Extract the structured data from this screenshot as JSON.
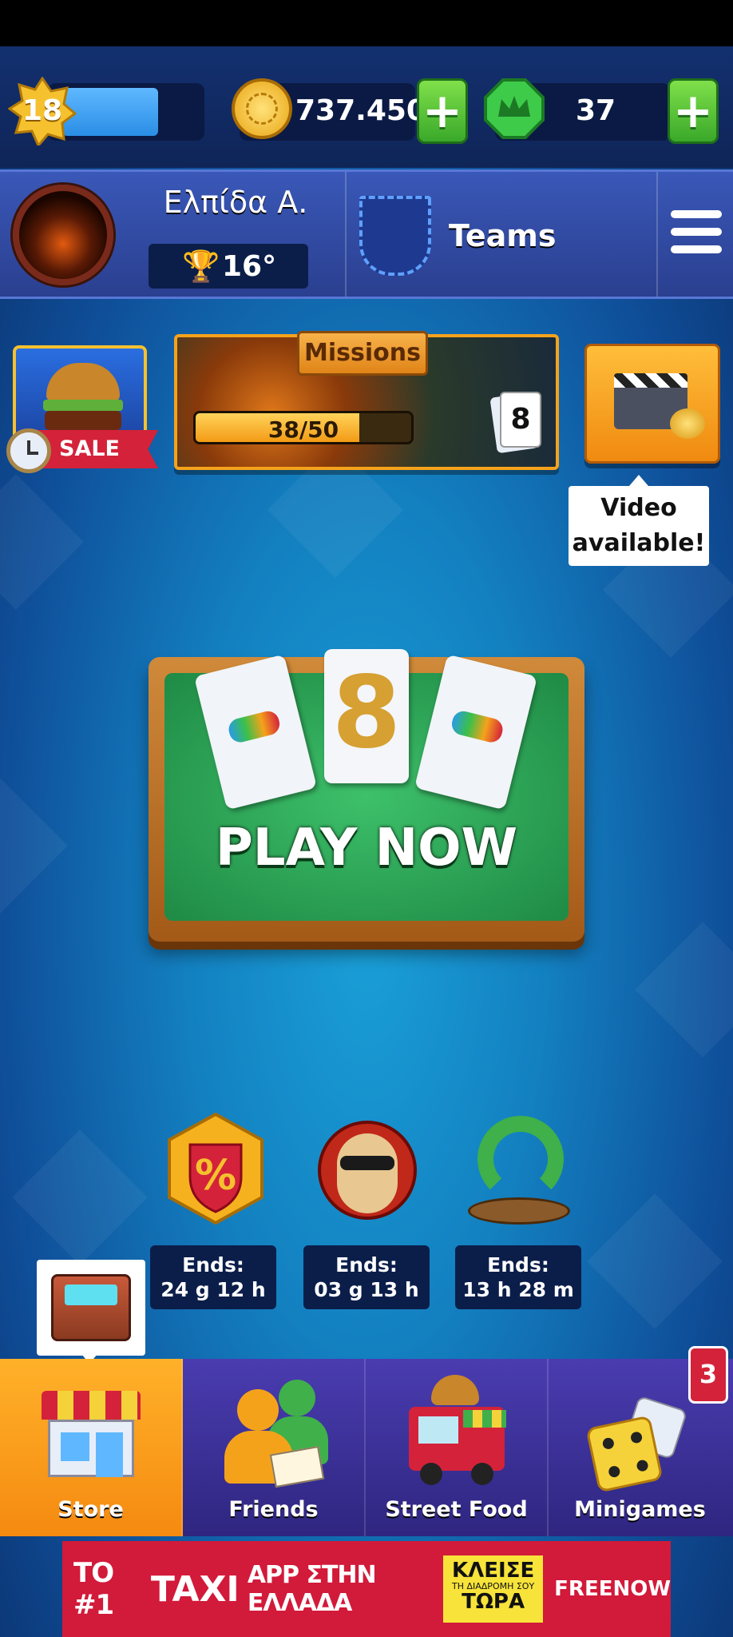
{
  "level": "18",
  "coins": "737.450",
  "gems": "37",
  "profile": {
    "name": "Ελπίδα Α.",
    "rank": "16°"
  },
  "teams_label": "Teams",
  "sale_label": "SALE",
  "missions": {
    "title": "Missions",
    "progress": "38/50",
    "progress_fraction": 0.76,
    "cards": "8"
  },
  "video": {
    "line1": "Video",
    "line2": "available!"
  },
  "play_label": "PLAY NOW",
  "events": [
    {
      "icon": "discount-shield-icon",
      "ends_label": "Ends:",
      "time": "24 g 12 h"
    },
    {
      "icon": "chef-mascot-icon",
      "ends_label": "Ends:",
      "time": "03 g 13 h"
    },
    {
      "icon": "beanstalk-icon",
      "ends_label": "Ends:",
      "time": "13 h 28 m"
    }
  ],
  "nav": [
    {
      "label": "Store"
    },
    {
      "label": "Friends"
    },
    {
      "label": "Street Food"
    },
    {
      "label": "Minigames",
      "badge": "3"
    }
  ],
  "ad": {
    "text1": "ΤΟ #1",
    "text2": "TAXI",
    "text3": "APP ΣΤΗΝ ΕΛΛΑΔΑ",
    "cta_line1": "ΚΛΕΙΣΕ",
    "cta_line2": "ΤΗ ΔΙΑΔΡΟΜΗ ΣΟΥ",
    "cta_line3": "ΤΩΡΑ",
    "brand": "FREENOW"
  },
  "colors": {
    "accent_green": "#3aa82a",
    "accent_orange": "#f7a21b",
    "nav_selected": "#f7a21b"
  }
}
